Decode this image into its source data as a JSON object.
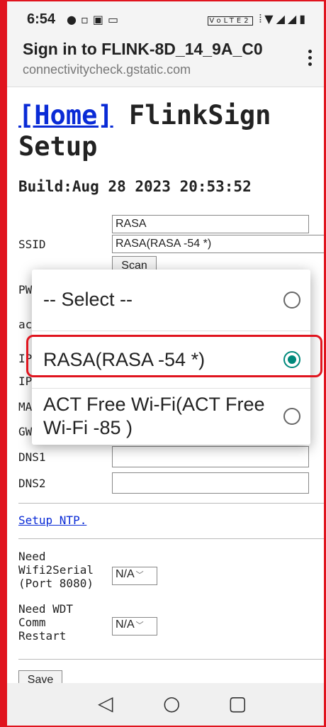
{
  "status_bar": {
    "time": "6:54",
    "left_icons": [
      "messenger-icon",
      "notification-icon",
      "image-icon",
      "keyboard-icon"
    ],
    "right_icons": [
      "volte-icon",
      "vibrate-icon",
      "wifi-icon",
      "signal-icon",
      "signal-x-icon",
      "battery-icon"
    ],
    "volte_text": "VoLTE2"
  },
  "app_bar": {
    "title": "Sign in to FLINK-8D_14_9A_C0",
    "subtitle": "connectivitycheck.gstatic.com"
  },
  "page": {
    "home_link": "[Home]",
    "title": " FlinkSign Setup",
    "build": "Build:Aug 28 2023 20:53:52",
    "ssid_text_value": "RASA",
    "ssid_label": "SSID",
    "ssid_select_value": "RASA(RASA -54 *)",
    "scan_button": "Scan",
    "pw_label_partial": "PW",
    "ac_label_partial": "ac",
    "ip1_label_partial": "IP",
    "ip2_label_partial": "IP",
    "mac_label_partial": "MA",
    "gw_label_partial": "GW",
    "dns1_label": "DNS1",
    "dns2_label": "DNS2",
    "setup_ntp_link": "Setup NTP.",
    "wifi2serial_label": "Need\nWifi2Serial\n(Port 8080)",
    "wifi2serial_value": "N/A",
    "wdt_label": "Need WDT\nComm\nRestart",
    "wdt_value": "N/A",
    "save_button": "Save"
  },
  "dialog": {
    "options": [
      {
        "label": "-- Select --",
        "selected": false
      },
      {
        "label": "RASA(RASA -54 *)",
        "selected": true
      },
      {
        "label": "ACT Free Wi-Fi(ACT Free Wi-Fi -85 )",
        "selected": false
      }
    ]
  },
  "colors": {
    "accent": "#00897b",
    "highlight": "#e0141e",
    "link": "#0a2bd6"
  }
}
